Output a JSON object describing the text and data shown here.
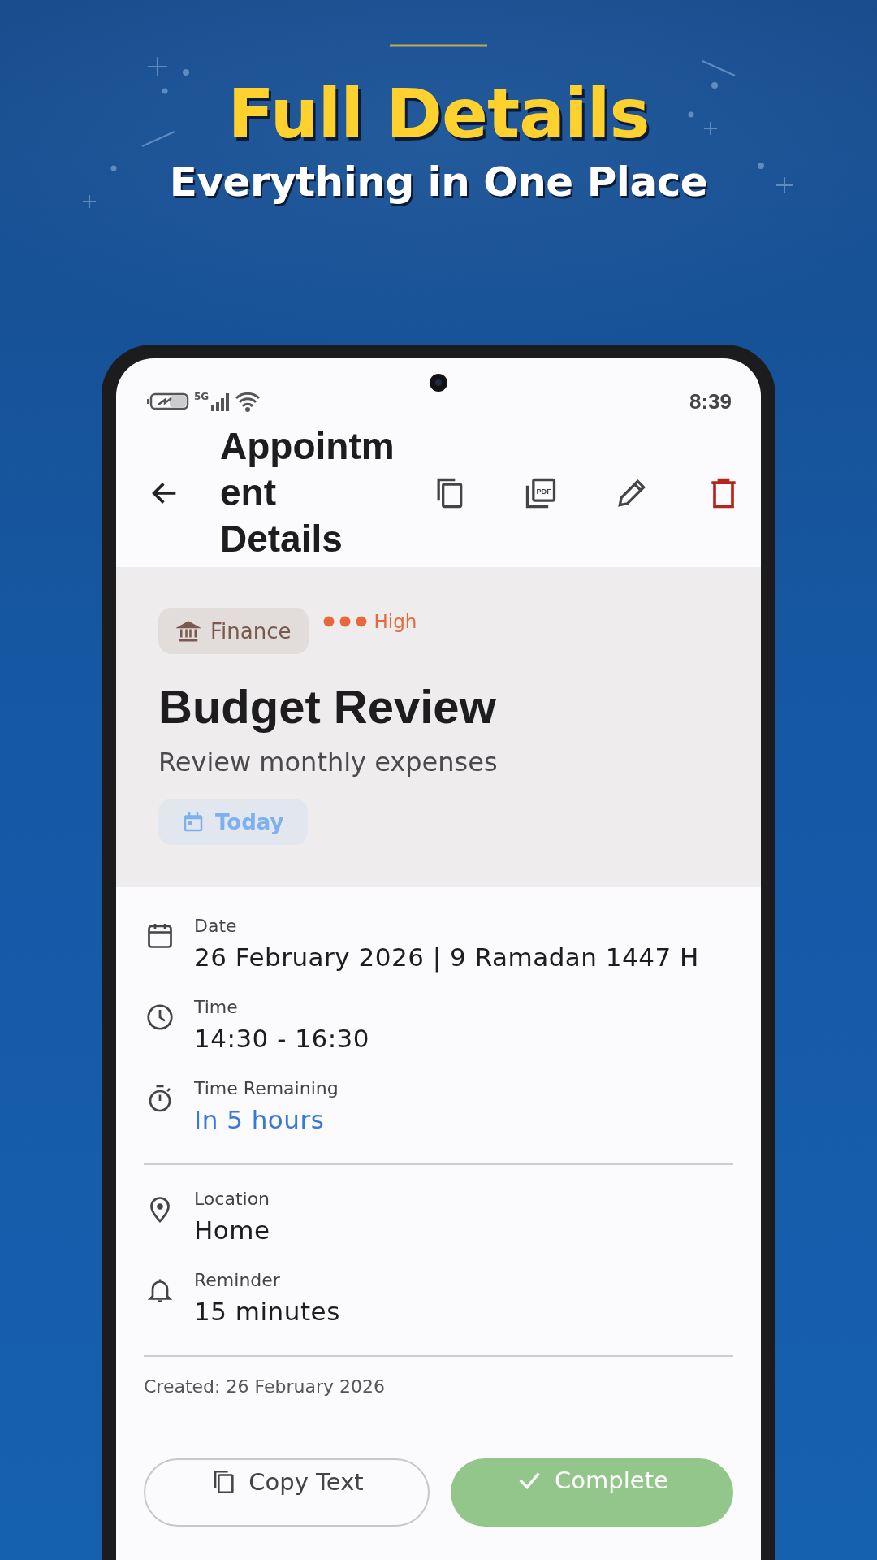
{
  "promo": {
    "headline": "Full Details",
    "subheadline": "Everything in One Place"
  },
  "status_bar": {
    "network": "5G",
    "time": "8:39"
  },
  "app_bar": {
    "title": "Appointment Details",
    "actions": [
      {
        "kind": "copy"
      },
      {
        "kind": "pdf",
        "icon_text": "PDF"
      },
      {
        "kind": "edit"
      },
      {
        "kind": "delete"
      }
    ]
  },
  "header": {
    "category": {
      "label": "Finance"
    },
    "priority": {
      "kind": "high",
      "label": "High"
    },
    "title": "Budget Review",
    "description": "Review monthly expenses",
    "due_chip": {
      "label": "Today"
    }
  },
  "sections": [
    {
      "items": [
        {
          "kind": "date",
          "label": "Date",
          "value": "26 February 2026 | 9 Ramadan 1447 H"
        },
        {
          "kind": "time",
          "label": "Time",
          "value": "14:30 - 16:30"
        },
        {
          "kind": "remaining",
          "label": "Time Remaining",
          "value": "In 5 hours"
        }
      ]
    },
    {
      "items": [
        {
          "kind": "location",
          "label": "Location",
          "value": "Home"
        },
        {
          "kind": "reminder",
          "label": "Reminder",
          "value": "15 minutes"
        }
      ]
    }
  ],
  "created": "Created: 26 February 2026",
  "buttons": [
    {
      "kind": "outlined",
      "label": "Copy Text"
    },
    {
      "kind": "filled",
      "label": "Complete"
    }
  ]
}
